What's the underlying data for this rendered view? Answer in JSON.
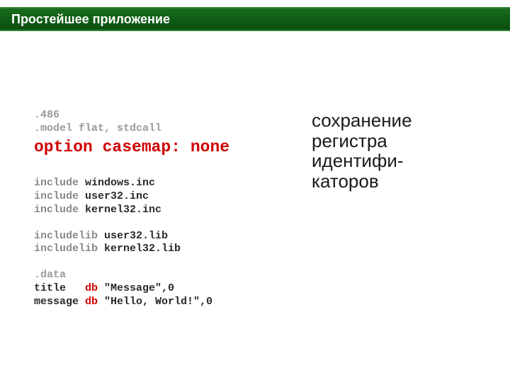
{
  "header": {
    "title": "Простейшее приложение"
  },
  "code": {
    "l1": ".486",
    "l2": ".model flat, stdcall",
    "highlight": "option casemap: none",
    "inc1_kw": "include",
    "inc1_nm": " windows.inc",
    "inc2_kw": "include",
    "inc2_nm": " user32.inc",
    "inc3_kw": "include",
    "inc3_nm": " kernel32.inc",
    "lib1_kw": "includelib",
    "lib1_nm": " user32.lib",
    "lib2_kw": "includelib",
    "lib2_nm": " kernel32.lib",
    "data_label": ".data",
    "d1_name": "title   ",
    "d1_db": "db",
    "d1_val": " \"Message\",0",
    "d2_name": "message ",
    "d2_db": "db",
    "d2_val": " \"Hello, World!\",0"
  },
  "callout": {
    "line1": "сохранение",
    "line2": "регистра",
    "line3": "идентифи-",
    "line4": "каторов"
  }
}
